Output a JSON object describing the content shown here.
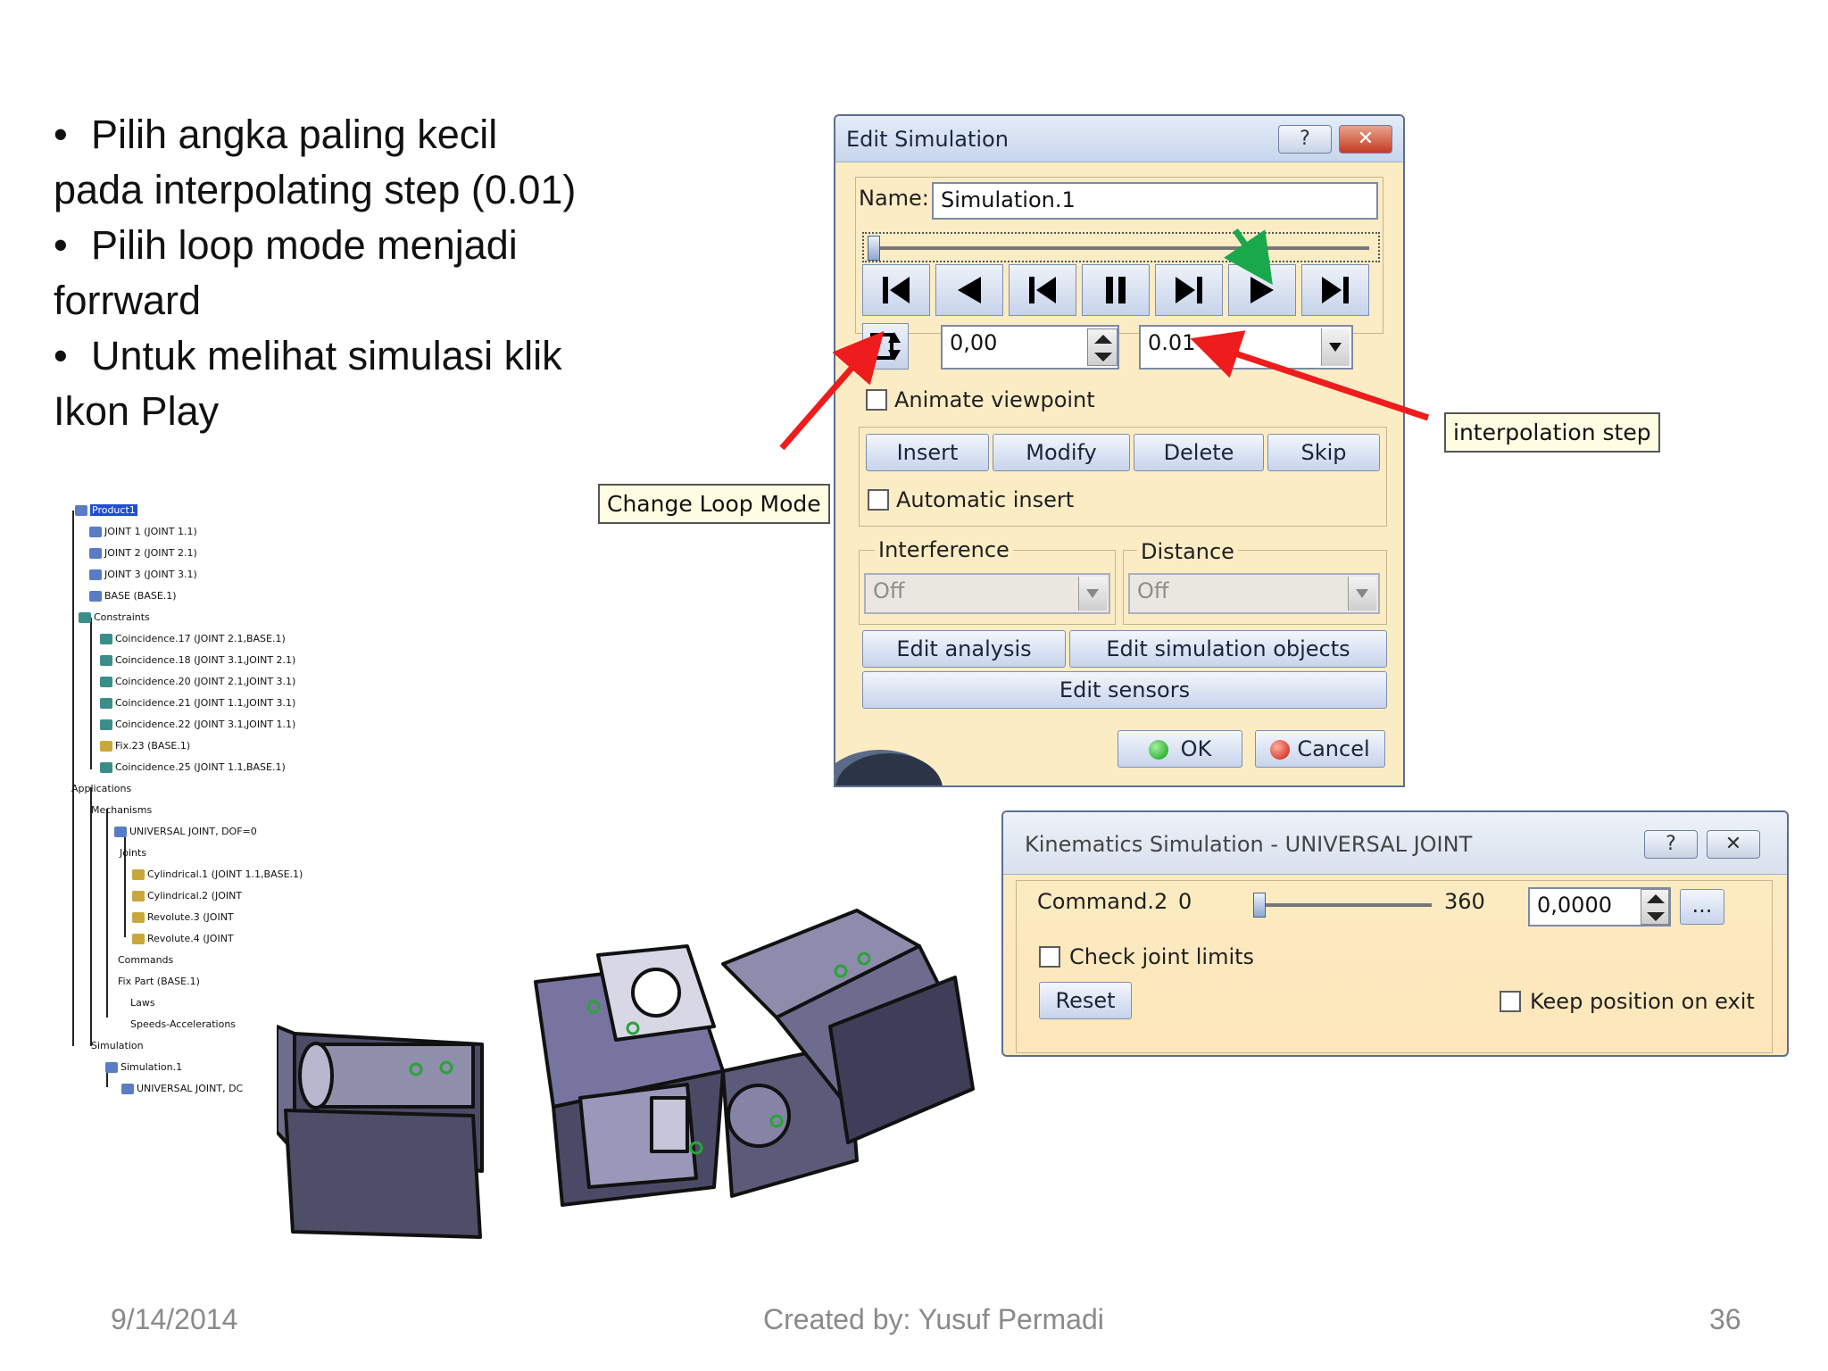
{
  "slide": {
    "bullets": [
      {
        "bullet": "•",
        "line1": "Pilih angka paling kecil",
        "line2": "pada interpolating step (0.01)"
      },
      {
        "bullet": "•",
        "line1": "Pilih loop mode menjadi",
        "line2": "forrward"
      },
      {
        "bullet": "•",
        "line1": "Untuk melihat simulasi klik",
        "line2": "Ikon Play"
      }
    ],
    "footer": {
      "date": "9/14/2014",
      "author": "Created by: Yusuf Permadi",
      "page": "36"
    }
  },
  "edit_simulation": {
    "title": "Edit Simulation",
    "help_icon": "?",
    "close_icon": "✕",
    "name_label": "Name:",
    "name_value": "Simulation.1",
    "time_value": "0,00",
    "step_value": "0.01",
    "animate_viewpoint": "Animate viewpoint",
    "insert": "Insert",
    "modify": "Modify",
    "delete": "Delete",
    "skip": "Skip",
    "automatic_insert": "Automatic insert",
    "interference_label": "Interference",
    "interference_value": "Off",
    "distance_label": "Distance",
    "distance_value": "Off",
    "edit_analysis": "Edit analysis",
    "edit_simulation_objects": "Edit simulation objects",
    "edit_sensors": "Edit sensors",
    "ok": "OK",
    "cancel": "Cancel",
    "playback_icons": [
      "jump-to-start-icon",
      "play-backward-icon",
      "step-backward-icon",
      "pause-icon",
      "step-forward-icon",
      "play-forward-icon",
      "jump-to-end-icon"
    ],
    "loop_mode_icon": "change-loop-mode-icon"
  },
  "callouts": {
    "change_loop_mode": "Change Loop Mode",
    "interpolation_step": "interpolation step"
  },
  "kinematics": {
    "title": "Kinematics Simulation - UNIVERSAL JOINT",
    "help_icon": "?",
    "close_icon": "✕",
    "command_label": "Command.2",
    "min": "0",
    "max": "360",
    "value": "0,0000",
    "more": "...",
    "check_joint_limits": "Check joint limits",
    "reset": "Reset",
    "keep_position": "Keep position on exit"
  },
  "tree": {
    "items": [
      "Product1",
      "JOINT 1 (JOINT 1.1)",
      "JOINT 2 (JOINT 2.1)",
      "JOINT 3 (JOINT 3.1)",
      "BASE (BASE.1)",
      "Constraints",
      "Coincidence.17 (JOINT 2.1,BASE.1)",
      "Coincidence.18 (JOINT 3.1,JOINT 2.1)",
      "Coincidence.20 (JOINT 2.1,JOINT 3.1)",
      "Coincidence.21 (JOINT 1.1,JOINT 3.1)",
      "Coincidence.22 (JOINT 3.1,JOINT 1.1)",
      "Fix.23 (BASE.1)",
      "Coincidence.25 (JOINT 1.1,BASE.1)",
      "Applications",
      "Mechanisms",
      "UNIVERSAL JOINT, DOF=0",
      "Joints",
      "Cylindrical.1 (JOINT 1.1,BASE.1)",
      "Cylindrical.2 (JOINT",
      "Revolute.3 (JOINT",
      "Revolute.4 (JOINT",
      "Commands",
      "Fix Part (BASE.1)",
      "Laws",
      "Speeds-Accelerations",
      "Simulation",
      "Simulation.1",
      "UNIVERSAL JOINT, DC"
    ]
  },
  "colors": {
    "dialog_bg": "#fcecc4",
    "arrow_red": "#ee1c1c",
    "arrow_green": "#19a84b",
    "model": "#5c5b78"
  }
}
